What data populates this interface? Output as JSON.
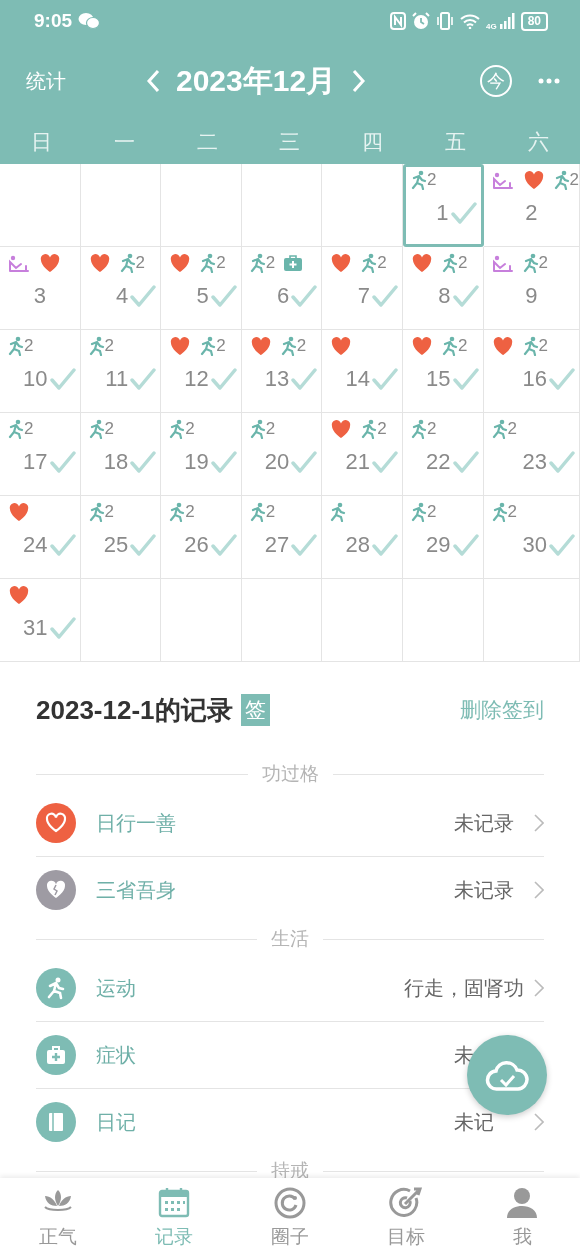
{
  "status_bar": {
    "time": "9:05",
    "network": "4G",
    "battery": "80"
  },
  "header": {
    "left": "统计",
    "title": "2023年12月",
    "today": "今"
  },
  "weekdays": [
    "日",
    "一",
    "二",
    "三",
    "四",
    "五",
    "六"
  ],
  "calendar": {
    "weeks": [
      [
        {
          "kind": "blank"
        },
        {
          "kind": "blank"
        },
        {
          "kind": "blank"
        },
        {
          "kind": "blank"
        },
        {
          "kind": "blank"
        },
        {
          "kind": "day",
          "day": "1",
          "checked": true,
          "selected": true,
          "marks": [
            {
              "kind": "run",
              "count": "2"
            }
          ]
        },
        {
          "kind": "day",
          "day": "2",
          "checked": false,
          "selected": false,
          "marks": [
            {
              "kind": "yoga"
            },
            {
              "kind": "heart"
            },
            {
              "kind": "run",
              "count": "2"
            }
          ]
        }
      ],
      [
        {
          "kind": "day",
          "day": "3",
          "checked": false,
          "selected": false,
          "marks": [
            {
              "kind": "yoga"
            },
            {
              "kind": "heart"
            }
          ]
        },
        {
          "kind": "day",
          "day": "4",
          "checked": true,
          "selected": false,
          "marks": [
            {
              "kind": "heart"
            },
            {
              "kind": "run",
              "count": "2"
            }
          ]
        },
        {
          "kind": "day",
          "day": "5",
          "checked": true,
          "selected": false,
          "marks": [
            {
              "kind": "heart"
            },
            {
              "kind": "run",
              "count": "2"
            }
          ]
        },
        {
          "kind": "day",
          "day": "6",
          "checked": true,
          "selected": false,
          "marks": [
            {
              "kind": "run",
              "count": "2"
            },
            {
              "kind": "medkit"
            }
          ]
        },
        {
          "kind": "day",
          "day": "7",
          "checked": true,
          "selected": false,
          "marks": [
            {
              "kind": "heart"
            },
            {
              "kind": "run",
              "count": "2"
            }
          ]
        },
        {
          "kind": "day",
          "day": "8",
          "checked": true,
          "selected": false,
          "marks": [
            {
              "kind": "heart"
            },
            {
              "kind": "run",
              "count": "2"
            }
          ]
        },
        {
          "kind": "day",
          "day": "9",
          "checked": false,
          "selected": false,
          "marks": [
            {
              "kind": "yoga"
            },
            {
              "kind": "run",
              "count": "2"
            }
          ]
        }
      ],
      [
        {
          "kind": "day",
          "day": "10",
          "checked": true,
          "selected": false,
          "marks": [
            {
              "kind": "run",
              "count": "2"
            }
          ]
        },
        {
          "kind": "day",
          "day": "11",
          "checked": true,
          "selected": false,
          "marks": [
            {
              "kind": "run",
              "count": "2"
            }
          ]
        },
        {
          "kind": "day",
          "day": "12",
          "checked": true,
          "selected": false,
          "marks": [
            {
              "kind": "heart"
            },
            {
              "kind": "run",
              "count": "2"
            }
          ]
        },
        {
          "kind": "day",
          "day": "13",
          "checked": true,
          "selected": false,
          "marks": [
            {
              "kind": "heart"
            },
            {
              "kind": "run",
              "count": "2"
            }
          ]
        },
        {
          "kind": "day",
          "day": "14",
          "checked": true,
          "selected": false,
          "marks": [
            {
              "kind": "heart"
            }
          ]
        },
        {
          "kind": "day",
          "day": "15",
          "checked": true,
          "selected": false,
          "marks": [
            {
              "kind": "heart"
            },
            {
              "kind": "run",
              "count": "2"
            }
          ]
        },
        {
          "kind": "day",
          "day": "16",
          "checked": true,
          "selected": false,
          "marks": [
            {
              "kind": "heart"
            },
            {
              "kind": "run",
              "count": "2"
            }
          ]
        }
      ],
      [
        {
          "kind": "day",
          "day": "17",
          "checked": true,
          "selected": false,
          "marks": [
            {
              "kind": "run",
              "count": "2"
            }
          ]
        },
        {
          "kind": "day",
          "day": "18",
          "checked": true,
          "selected": false,
          "marks": [
            {
              "kind": "run",
              "count": "2"
            }
          ]
        },
        {
          "kind": "day",
          "day": "19",
          "checked": true,
          "selected": false,
          "marks": [
            {
              "kind": "run",
              "count": "2"
            }
          ]
        },
        {
          "kind": "day",
          "day": "20",
          "checked": true,
          "selected": false,
          "marks": [
            {
              "kind": "run",
              "count": "2"
            }
          ]
        },
        {
          "kind": "day",
          "day": "21",
          "checked": true,
          "selected": false,
          "marks": [
            {
              "kind": "heart"
            },
            {
              "kind": "run",
              "count": "2"
            }
          ]
        },
        {
          "kind": "day",
          "day": "22",
          "checked": true,
          "selected": false,
          "marks": [
            {
              "kind": "run",
              "count": "2"
            }
          ]
        },
        {
          "kind": "day",
          "day": "23",
          "checked": true,
          "selected": false,
          "marks": [
            {
              "kind": "run",
              "count": "2"
            }
          ]
        }
      ],
      [
        {
          "kind": "day",
          "day": "24",
          "checked": true,
          "selected": false,
          "marks": [
            {
              "kind": "heart"
            }
          ]
        },
        {
          "kind": "day",
          "day": "25",
          "checked": true,
          "selected": false,
          "marks": [
            {
              "kind": "run",
              "count": "2"
            }
          ]
        },
        {
          "kind": "day",
          "day": "26",
          "checked": true,
          "selected": false,
          "marks": [
            {
              "kind": "run",
              "count": "2"
            }
          ]
        },
        {
          "kind": "day",
          "day": "27",
          "checked": true,
          "selected": false,
          "marks": [
            {
              "kind": "run",
              "count": "2"
            }
          ]
        },
        {
          "kind": "day",
          "day": "28",
          "checked": true,
          "selected": false,
          "marks": [
            {
              "kind": "run"
            }
          ]
        },
        {
          "kind": "day",
          "day": "29",
          "checked": true,
          "selected": false,
          "marks": [
            {
              "kind": "run",
              "count": "2"
            }
          ]
        },
        {
          "kind": "day",
          "day": "30",
          "checked": true,
          "selected": false,
          "marks": [
            {
              "kind": "run",
              "count": "2"
            }
          ]
        }
      ],
      [
        {
          "kind": "day",
          "day": "31",
          "checked": true,
          "selected": false,
          "marks": [
            {
              "kind": "heart"
            }
          ]
        },
        {
          "kind": "blank"
        },
        {
          "kind": "blank"
        },
        {
          "kind": "blank"
        },
        {
          "kind": "blank"
        },
        {
          "kind": "blank"
        },
        {
          "kind": "blank"
        }
      ]
    ]
  },
  "record": {
    "date_title": "2023-12-1的记录",
    "badge": "签",
    "action": "删除签到",
    "sections": [
      {
        "title": "功过格",
        "items": [
          {
            "kind": "heart",
            "label": "日行一善",
            "value": "未记录",
            "chevron": true
          },
          {
            "kind": "broken-heart",
            "label": "三省吾身",
            "value": "未记录",
            "chevron": true
          }
        ]
      },
      {
        "title": "生活",
        "items": [
          {
            "kind": "run",
            "label": "运动",
            "value": "行走，固肾功",
            "chevron": true
          },
          {
            "kind": "medkit",
            "label": "症状",
            "value": "未",
            "chevron": false
          },
          {
            "kind": "book",
            "label": "日记",
            "value": "未记",
            "chevron": true
          }
        ]
      },
      {
        "title": "持戒"
      }
    ]
  },
  "tab_bar": [
    {
      "kind": "lotus",
      "label": "正气",
      "selected": false
    },
    {
      "kind": "calendar",
      "label": "记录",
      "selected": true
    },
    {
      "kind": "ring",
      "label": "圈子",
      "selected": false
    },
    {
      "kind": "target",
      "label": "目标",
      "selected": false
    },
    {
      "kind": "person",
      "label": "我",
      "selected": false
    }
  ]
}
